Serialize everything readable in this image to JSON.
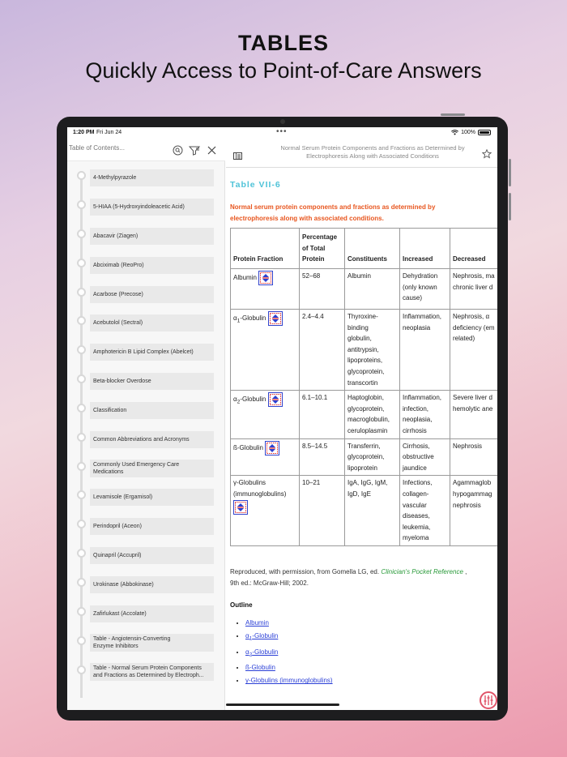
{
  "headline": {
    "title": "TABLES",
    "subtitle": "Quickly Access to Point-of-Care Answers"
  },
  "status_bar": {
    "time": "1:20 PM",
    "date": "Fri Jun 24",
    "battery": "100%"
  },
  "sidebar": {
    "search_placeholder": "Table of Contents...",
    "items": [
      {
        "label": "4-Methylpyrazole"
      },
      {
        "label": "5-HIAA (5-Hydroxyindoleacetic Acid)"
      },
      {
        "label": "Abacavir (Ziagen)"
      },
      {
        "label": "Abciximab (ReoPro)"
      },
      {
        "label": "Acarbose (Precose)"
      },
      {
        "label": "Acebutolol (Sectral)"
      },
      {
        "label": "Amphotericin B Lipid Complex (Abelcet)"
      },
      {
        "label": "Beta-blocker Overdose"
      },
      {
        "label": "Classification"
      },
      {
        "label": "Common Abbreviations and Acronyms"
      },
      {
        "label_1": "Commonly Used Emergency Care",
        "label_2": "Medications"
      },
      {
        "label": "Levamisole (Ergamisol)"
      },
      {
        "label": "Perindopril (Aceon)"
      },
      {
        "label": "Quinapril (Accupril)"
      },
      {
        "label": "Urokinase (Abbokinase)"
      },
      {
        "label": "Zafirlukast (Accolate)"
      },
      {
        "label_1": "Table - Angiotensin-Converting",
        "label_2": "Enzyme Inhibitors"
      },
      {
        "label_1": "Table - Normal Serum Protein Components",
        "label_2": "and Fractions as Determined by Electroph..."
      }
    ]
  },
  "content": {
    "doc_title_1": "Normal Serum Protein Components and Fractions as Determined by",
    "doc_title_2": "Electrophoresis Along with Associated Conditions",
    "table_label": "Table VII-6",
    "caption_1": "Normal serum protein components and fractions as determined by",
    "caption_2": "electrophoresis along with associated conditions.",
    "table": {
      "headers": {
        "fraction": "Protein Fraction",
        "percent_1": "Percentage",
        "percent_2": "of Total",
        "percent_3": "Protein",
        "constituents": "Constituents",
        "increased": "Increased",
        "decreased": "Decreased"
      },
      "rows": [
        {
          "fraction": "Albumin",
          "percent": "52–68",
          "constituents": [
            "Albumin"
          ],
          "increased": [
            "Dehydration",
            "(only known",
            "cause)"
          ],
          "decreased": [
            "Nephrosis, ma",
            "chronic liver d"
          ]
        },
        {
          "fraction_prefix": "α",
          "fraction_sub": "1",
          "fraction": "-Globulin",
          "percent": "2.4–4.4",
          "constituents": [
            "Thyroxine-",
            "binding",
            "globulin,",
            "antitrypsin,",
            "lipoproteins,",
            "glycoprotein,",
            "transcortin"
          ],
          "increased": [
            "Inflammation,",
            "neoplasia"
          ],
          "decreased": [
            "Nephrosis, α",
            "deficiency (em",
            "related)"
          ]
        },
        {
          "fraction_prefix": "α",
          "fraction_sub": "2",
          "fraction": "-Globulin",
          "percent": "6.1–10.1",
          "constituents": [
            "Haptoglobin,",
            "glycoprotein,",
            "macroglobulin,",
            "ceruloplasmin"
          ],
          "increased": [
            "Inflammation,",
            "infection,",
            "neoplasia,",
            "cirrhosis"
          ],
          "decreased": [
            "Severe liver d",
            "hemolytic ane"
          ]
        },
        {
          "fraction": "ß-Globulin",
          "percent": "8.5–14.5",
          "constituents": [
            "Transferrin,",
            "glycoprotein,",
            "lipoprotein"
          ],
          "increased": [
            "Cirrhosis,",
            "obstructive",
            "jaundice"
          ],
          "decreased": [
            "Nephrosis"
          ]
        },
        {
          "fraction": "γ-Globulins",
          "fraction_2": "(immunoglobulins)",
          "percent": "10–21",
          "constituents": [
            "IgA, IgG, IgM,",
            "IgD, IgE"
          ],
          "increased": [
            "Infections,",
            "collagen-",
            "vascular",
            "diseases,",
            "leukemia,",
            "myeloma"
          ],
          "decreased": [
            "Agammaglob",
            "hypogammag",
            "nephrosis"
          ]
        }
      ]
    },
    "reference_prefix": "Reproduced, with permission, from Gomella LG, ed.",
    "reference_book": "Clinician's Pocket Reference",
    "reference_suffix": ",",
    "reference_line2": "9th ed.: McGraw-Hill; 2002.",
    "outline_title": "Outline",
    "outline": [
      {
        "text": "Albumin"
      },
      {
        "prefix": "α",
        "sub": "1",
        "text": "-Globulin"
      },
      {
        "prefix": "α",
        "sub": "2",
        "text": "-Globulin"
      },
      {
        "text": "ß-Globulin"
      },
      {
        "text": "γ-Globulins (immunoglobulins)"
      }
    ]
  }
}
